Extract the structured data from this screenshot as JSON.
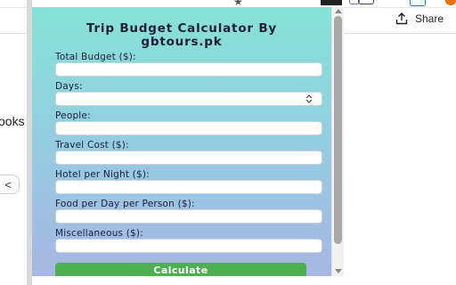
{
  "browser": {
    "star_glyph": "★",
    "share_label": "Share",
    "page_fragment_text": "ooks",
    "back_pill_glyph": "<"
  },
  "popup": {
    "title": "Trip Budget Calculator By gbtours.pk",
    "fields": [
      {
        "label": "Total Budget ($):",
        "value": "",
        "type": "text"
      },
      {
        "label": "Days:",
        "value": "",
        "type": "number"
      },
      {
        "label": "People:",
        "value": "",
        "type": "text"
      },
      {
        "label": "Travel Cost ($):",
        "value": "",
        "type": "text"
      },
      {
        "label": "Hotel per Night ($):",
        "value": "",
        "type": "text"
      },
      {
        "label": "Food per Day per Person ($):",
        "value": "",
        "type": "text"
      },
      {
        "label": "Miscellaneous ($):",
        "value": "",
        "type": "text"
      }
    ],
    "calculate_label": "Calculate"
  },
  "colors": {
    "gradient_top": "#86e3d6",
    "gradient_bottom": "#a8b6e4",
    "button": "#4caf50"
  }
}
